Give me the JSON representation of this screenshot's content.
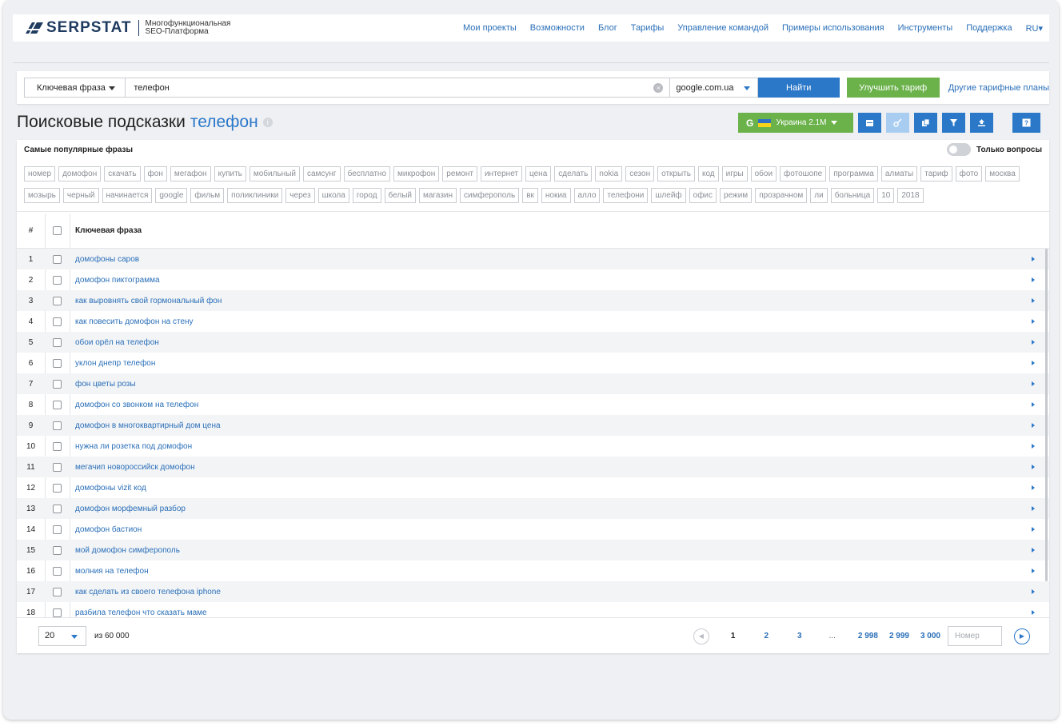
{
  "brand": {
    "name": "SERPSTAT",
    "tagline_line1": "Многофункциональная",
    "tagline_line2": "SEO-Платформа",
    "logo_color": "#1e3a5f"
  },
  "nav": {
    "items": [
      "Мои проекты",
      "Возможности",
      "Блог",
      "Тарифы",
      "Управление командой",
      "Примеры использования",
      "Инструменты",
      "Поддержка",
      "RU▾"
    ]
  },
  "search": {
    "type_label": "Ключевая фраза",
    "query": "телефон",
    "database": "google.com.ua",
    "find_label": "Найти",
    "upgrade_label": "Улучшить тариф",
    "plans_link": "Другие тарифные планы"
  },
  "page": {
    "title": "Поисковые подсказки",
    "keyword": "телефон"
  },
  "toolbar": {
    "engine_icon": "G",
    "region_label": "Украина 2.1M",
    "icons": [
      "calendar-icon",
      "key-icon",
      "copy-icon",
      "filter-icon",
      "export-icon",
      "help-icon"
    ]
  },
  "popular": {
    "title": "Самые популярные фразы",
    "only_questions_label": "Только вопросы",
    "tags": [
      "номер",
      "домофон",
      "скачать",
      "фон",
      "мегафон",
      "купить",
      "мобильный",
      "самсунг",
      "бесплатно",
      "микрофон",
      "ремонт",
      "интернет",
      "цена",
      "сделать",
      "nokia",
      "сезон",
      "открыть",
      "код",
      "игры",
      "обои",
      "фотошопе",
      "программа",
      "алматы",
      "тариф",
      "фото",
      "москва",
      "мозырь",
      "черный",
      "начинается",
      "google",
      "фильм",
      "поликлиники",
      "через",
      "школа",
      "город",
      "белый",
      "магазин",
      "симферополь",
      "вк",
      "нокиа",
      "алло",
      "телефони",
      "шлейф",
      "офис",
      "режим",
      "прозрачном",
      "ли",
      "больница",
      "10",
      "2018"
    ]
  },
  "table": {
    "col_num": "#",
    "col_keyword": "Ключевая фраза",
    "rows": [
      {
        "n": "1",
        "kw": "домофоны саров"
      },
      {
        "n": "2",
        "kw": "домофон пиктограмма"
      },
      {
        "n": "3",
        "kw": "как выровнять свой гормональный фон"
      },
      {
        "n": "4",
        "kw": "как повесить домофон на стену"
      },
      {
        "n": "5",
        "kw": "обои орёл на телефон"
      },
      {
        "n": "6",
        "kw": "уклон днепр телефон"
      },
      {
        "n": "7",
        "kw": "фон цветы розы"
      },
      {
        "n": "8",
        "kw": "домофон со звонком на телефон"
      },
      {
        "n": "9",
        "kw": "домофон в многоквартирный дом цена"
      },
      {
        "n": "10",
        "kw": "нужна ли розетка под домофон"
      },
      {
        "n": "11",
        "kw": "мегачип новороссийск домофон"
      },
      {
        "n": "12",
        "kw": "домофоны vizit код"
      },
      {
        "n": "13",
        "kw": "домофон морфемный разбор"
      },
      {
        "n": "14",
        "kw": "домофон бастион"
      },
      {
        "n": "15",
        "kw": "мой домофон симферополь"
      },
      {
        "n": "16",
        "kw": "молния на телефон"
      },
      {
        "n": "17",
        "kw": "как сделать из своего телефона iphone"
      },
      {
        "n": "18",
        "kw": "разбила телефон что сказать маме"
      }
    ]
  },
  "footer": {
    "per_page": "20",
    "of_total": "из 60 000",
    "pages": [
      "1",
      "2",
      "3",
      "...",
      "2 998",
      "2 999",
      "3 000"
    ],
    "page_input_placeholder": "Номер"
  },
  "colors": {
    "primary": "#2b78c9",
    "green": "#6bb24b",
    "link": "#2a6fb8"
  }
}
